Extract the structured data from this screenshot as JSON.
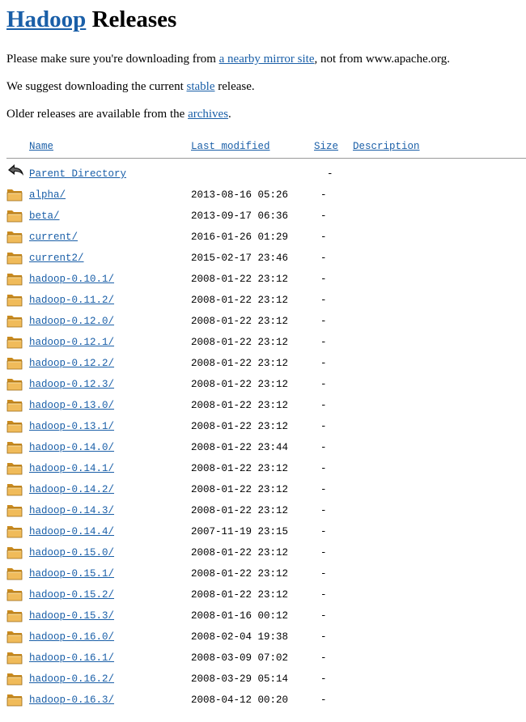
{
  "title": {
    "link": "Hadoop",
    "rest": " Releases"
  },
  "para1": {
    "before": "Please make sure you're downloading from ",
    "link": "a nearby mirror site",
    "after": ", not from www.apache.org."
  },
  "para2": {
    "before": "We suggest downloading the current ",
    "link": "stable",
    "after": " release."
  },
  "para3": {
    "before": "Older releases are available from the ",
    "link": "archives",
    "after": "."
  },
  "headers": {
    "name": "Name",
    "modified": "Last modified",
    "size": "Size",
    "description": "Description"
  },
  "parent": {
    "name": "Parent Directory",
    "size": "-"
  },
  "rows": [
    {
      "name": "alpha/",
      "date": "2013-08-16 05:26",
      "size": "-"
    },
    {
      "name": "beta/",
      "date": "2013-09-17 06:36",
      "size": "-"
    },
    {
      "name": "current/",
      "date": "2016-01-26 01:29",
      "size": "-"
    },
    {
      "name": "current2/",
      "date": "2015-02-17 23:46",
      "size": "-"
    },
    {
      "name": "hadoop-0.10.1/",
      "date": "2008-01-22 23:12",
      "size": "-"
    },
    {
      "name": "hadoop-0.11.2/",
      "date": "2008-01-22 23:12",
      "size": "-"
    },
    {
      "name": "hadoop-0.12.0/",
      "date": "2008-01-22 23:12",
      "size": "-"
    },
    {
      "name": "hadoop-0.12.1/",
      "date": "2008-01-22 23:12",
      "size": "-"
    },
    {
      "name": "hadoop-0.12.2/",
      "date": "2008-01-22 23:12",
      "size": "-"
    },
    {
      "name": "hadoop-0.12.3/",
      "date": "2008-01-22 23:12",
      "size": "-"
    },
    {
      "name": "hadoop-0.13.0/",
      "date": "2008-01-22 23:12",
      "size": "-"
    },
    {
      "name": "hadoop-0.13.1/",
      "date": "2008-01-22 23:12",
      "size": "-"
    },
    {
      "name": "hadoop-0.14.0/",
      "date": "2008-01-22 23:44",
      "size": "-"
    },
    {
      "name": "hadoop-0.14.1/",
      "date": "2008-01-22 23:12",
      "size": "-"
    },
    {
      "name": "hadoop-0.14.2/",
      "date": "2008-01-22 23:12",
      "size": "-"
    },
    {
      "name": "hadoop-0.14.3/",
      "date": "2008-01-22 23:12",
      "size": "-"
    },
    {
      "name": "hadoop-0.14.4/",
      "date": "2007-11-19 23:15",
      "size": "-"
    },
    {
      "name": "hadoop-0.15.0/",
      "date": "2008-01-22 23:12",
      "size": "-"
    },
    {
      "name": "hadoop-0.15.1/",
      "date": "2008-01-22 23:12",
      "size": "-"
    },
    {
      "name": "hadoop-0.15.2/",
      "date": "2008-01-22 23:12",
      "size": "-"
    },
    {
      "name": "hadoop-0.15.3/",
      "date": "2008-01-16 00:12",
      "size": "-"
    },
    {
      "name": "hadoop-0.16.0/",
      "date": "2008-02-04 19:38",
      "size": "-"
    },
    {
      "name": "hadoop-0.16.1/",
      "date": "2008-03-09 07:02",
      "size": "-"
    },
    {
      "name": "hadoop-0.16.2/",
      "date": "2008-03-29 05:14",
      "size": "-"
    },
    {
      "name": "hadoop-0.16.3/",
      "date": "2008-04-12 00:20",
      "size": "-"
    }
  ],
  "icons": {
    "parent": "back-arrow-icon",
    "folder": "folder-icon"
  },
  "colors": {
    "link": "#1a5fa8",
    "rule": "#9a9a9a",
    "folder": "#e8b04a"
  }
}
